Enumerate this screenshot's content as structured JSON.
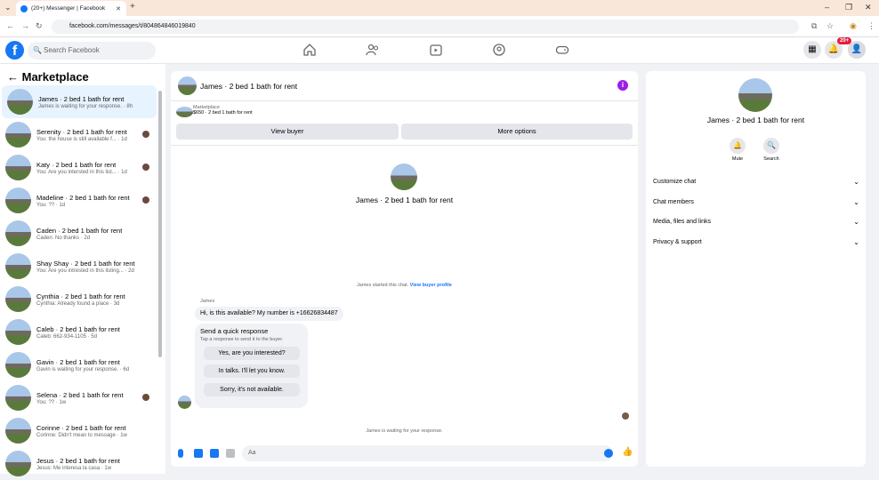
{
  "browser": {
    "tab_title": "(20+) Messenger | Facebook",
    "url": "facebook.com/messages/t/804864846019840"
  },
  "facebook": {
    "search_placeholder": "Search Facebook",
    "notification_badge": "20+"
  },
  "sidebar": {
    "title": "Marketplace",
    "conversations": [
      {
        "name": "James · 2 bed 1 bath for rent",
        "preview": "James is waiting for your response. · 8h",
        "active": true,
        "mini_avatar": false
      },
      {
        "name": "Serenity · 2 bed 1 bath for rent",
        "preview": "You: the house is still available f... · 1d",
        "active": false,
        "mini_avatar": true
      },
      {
        "name": "Katy · 2 bed 1 bath for rent",
        "preview": "You: Are you intersted in this list... · 1d",
        "active": false,
        "mini_avatar": true
      },
      {
        "name": "Madeline · 2 bed 1 bath for rent",
        "preview": "You: ?? · 1d",
        "active": false,
        "mini_avatar": true
      },
      {
        "name": "Caden · 2 bed 1 bath for rent",
        "preview": "Caden: No thanks · 2d",
        "active": false,
        "mini_avatar": false
      },
      {
        "name": "Shay Shay · 2 bed 1 bath for rent",
        "preview": "You: Are you intrested in this listing... · 2d",
        "active": false,
        "mini_avatar": false
      },
      {
        "name": "Cynthia · 2 bed 1 bath for rent",
        "preview": "Cynthia: Already found a place · 3d",
        "active": false,
        "mini_avatar": false
      },
      {
        "name": "Caleb · 2 bed 1 bath for rent",
        "preview": "Caleb: 662-934-1105 · 5d",
        "active": false,
        "mini_avatar": false
      },
      {
        "name": "Gavin · 2 bed 1 bath for rent",
        "preview": "Gavin is waiting for your response. · 6d",
        "active": false,
        "mini_avatar": false
      },
      {
        "name": "Selena · 2 bed 1 bath for rent",
        "preview": "You: ?? · 1w",
        "active": false,
        "mini_avatar": true
      },
      {
        "name": "Corinne · 2 bed 1 bath for rent",
        "preview": "Corinne: Didn't mean to message · 1w",
        "active": false,
        "mini_avatar": false
      },
      {
        "name": "Jesus · 2 bed 1 bath for rent",
        "preview": "Jesus: Me interesa la casa · 1w",
        "active": false,
        "mini_avatar": false
      }
    ]
  },
  "chat": {
    "title": "James · 2 bed 1 bath for rent",
    "marketplace_label": "Marketplace",
    "listing": "$650 · 2 bed 1 bath for rent",
    "view_buyer": "View buyer",
    "more_options": "More options",
    "profile_name": "James · 2 bed 1 bath for rent",
    "started_text": "James started this chat.",
    "view_buyer_profile": "View buyer profile",
    "sender": "James",
    "message": "Hi, is this available? My number is +16626834487",
    "quick_response_title": "Send a quick response",
    "quick_response_sub": "Tap a response to send it to the buyer.",
    "quick_responses": [
      "Yes, are you interested?",
      "In talks. I'll let you know.",
      "Sorry, it's not available."
    ],
    "waiting": "James is waiting for your response.",
    "composer_placeholder": "Aa"
  },
  "details": {
    "name": "James · 2 bed 1 bath for rent",
    "mute": "Mute",
    "search": "Search",
    "sections": [
      "Customize chat",
      "Chat members",
      "Media, files and links",
      "Privacy & support"
    ]
  },
  "colors": {
    "brand": "#1877f2",
    "info": "#9b1fe8",
    "badge": "#e41e3f"
  }
}
